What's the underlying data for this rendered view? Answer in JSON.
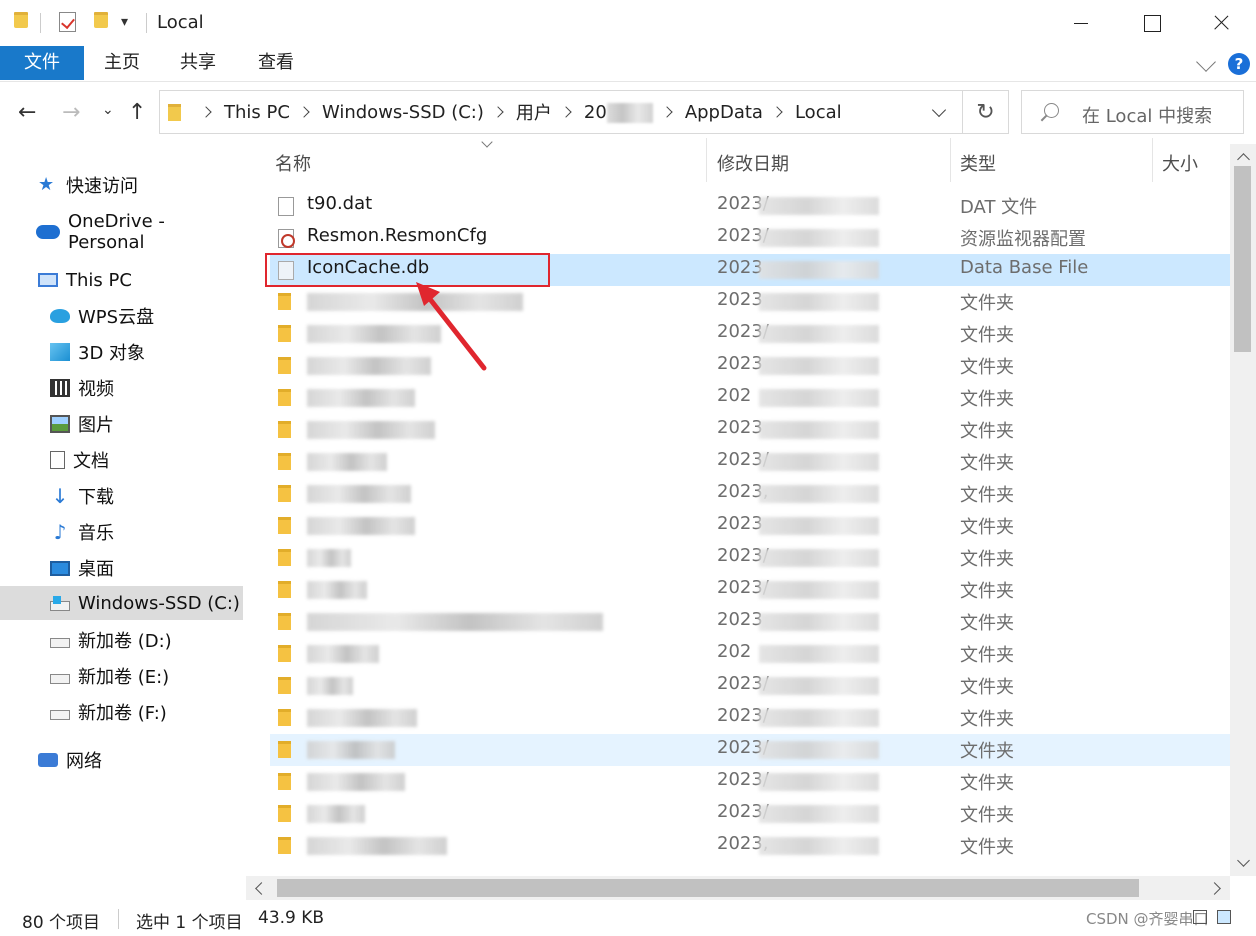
{
  "window": {
    "title": "Local"
  },
  "ribbon": {
    "tabs": [
      "文件",
      "主页",
      "共享",
      "查看"
    ],
    "help": "?"
  },
  "address": {
    "crumbs": [
      "This PC",
      "Windows-SSD (C:)",
      "用户",
      "20",
      "AppData",
      "Local"
    ],
    "search_placeholder": "在 Local 中搜索"
  },
  "nav": {
    "items": [
      {
        "label": "快速访问",
        "icon": "star-icon"
      },
      {
        "label": "OneDrive - Personal",
        "icon": "cloud-icon"
      },
      {
        "label": "This PC",
        "icon": "computer-icon"
      },
      {
        "label": "WPS云盘",
        "icon": "wps-cloud-icon"
      },
      {
        "label": "3D 对象",
        "icon": "cube-icon"
      },
      {
        "label": "视频",
        "icon": "video-icon"
      },
      {
        "label": "图片",
        "icon": "picture-icon"
      },
      {
        "label": "文档",
        "icon": "document-icon"
      },
      {
        "label": "下载",
        "icon": "download-icon"
      },
      {
        "label": "音乐",
        "icon": "music-icon"
      },
      {
        "label": "桌面",
        "icon": "desktop-icon"
      },
      {
        "label": "Windows-SSD (C:)",
        "icon": "system-drive-icon"
      },
      {
        "label": "新加卷 (D:)",
        "icon": "drive-icon"
      },
      {
        "label": "新加卷 (E:)",
        "icon": "drive-icon"
      },
      {
        "label": "新加卷 (F:)",
        "icon": "drive-icon"
      },
      {
        "label": "网络",
        "icon": "network-icon"
      }
    ]
  },
  "columns": {
    "name": "名称",
    "date": "修改日期",
    "type": "类型",
    "size": "大小"
  },
  "files": [
    {
      "name": "t90.dat",
      "date": "2023/",
      "type": "DAT 文件",
      "icon": "file-icon"
    },
    {
      "name": "Resmon.ResmonCfg",
      "date": "2023/",
      "type": "资源监视器配置",
      "icon": "config-file-icon"
    },
    {
      "name": "IconCache.db",
      "date": "2023",
      "type": "Data Base File",
      "icon": "database-file-icon"
    },
    {
      "name": "",
      "date": "2023",
      "type": "文件夹",
      "icon": "folder-icon"
    },
    {
      "name": "",
      "date": "2023/",
      "type": "文件夹",
      "icon": "folder-icon"
    },
    {
      "name": "",
      "date": "2023",
      "type": "文件夹",
      "icon": "folder-icon"
    },
    {
      "name": "",
      "date": "202",
      "type": "文件夹",
      "icon": "folder-icon"
    },
    {
      "name": "",
      "date": "2023",
      "type": "文件夹",
      "icon": "folder-icon"
    },
    {
      "name": "",
      "date": "2023/",
      "type": "文件夹",
      "icon": "folder-icon"
    },
    {
      "name": "",
      "date": "2023,",
      "type": "文件夹",
      "icon": "folder-icon"
    },
    {
      "name": "",
      "date": "2023",
      "type": "文件夹",
      "icon": "folder-icon"
    },
    {
      "name": "",
      "date": "2023/",
      "type": "文件夹",
      "icon": "folder-icon"
    },
    {
      "name": "",
      "date": "2023/",
      "type": "文件夹",
      "icon": "folder-icon"
    },
    {
      "name": "",
      "date": "2023",
      "type": "文件夹",
      "icon": "folder-icon"
    },
    {
      "name": "",
      "date": "202",
      "type": "文件夹",
      "icon": "folder-icon"
    },
    {
      "name": "",
      "date": "2023/",
      "type": "文件夹",
      "icon": "folder-icon"
    },
    {
      "name": "",
      "date": "2023/",
      "type": "文件夹",
      "icon": "folder-icon"
    },
    {
      "name": "",
      "date": "2023/",
      "type": "文件夹",
      "icon": "folder-icon"
    },
    {
      "name": "",
      "date": "2023/",
      "type": "文件夹",
      "icon": "folder-icon"
    },
    {
      "name": "",
      "date": "2023/",
      "type": "文件夹",
      "icon": "folder-icon"
    },
    {
      "name": "",
      "date": "2023,",
      "type": "文件夹",
      "icon": "folder-icon"
    }
  ],
  "status": {
    "count": "80 个项目",
    "selected": "选中 1 个项目",
    "size": "43.9 KB"
  },
  "watermark": "CSDN @齐婴串口",
  "colors": {
    "accent": "#1979ca",
    "selection": "#cce8ff",
    "annotation": "#e0262e"
  }
}
